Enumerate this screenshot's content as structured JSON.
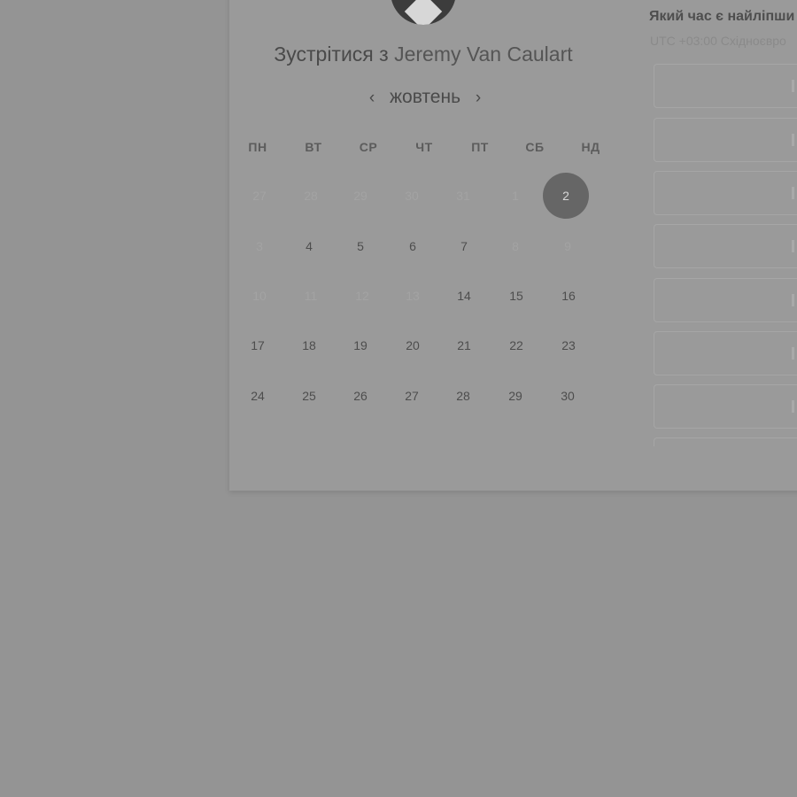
{
  "meeting": {
    "title_prefix": "Зустрітися з",
    "host_name": "Jeremy Van Caulart"
  },
  "calendar": {
    "month": "жовтень",
    "weekdays": [
      "ПН",
      "ВТ",
      "СР",
      "ЧТ",
      "ПТ",
      "СБ",
      "НД"
    ],
    "weeks": [
      [
        "27",
        "28",
        "29",
        "30",
        "31",
        "1",
        "2"
      ],
      [
        "3",
        "4",
        "5",
        "6",
        "7",
        "8",
        "9"
      ],
      [
        "10",
        "11",
        "12",
        "13",
        "14",
        "15",
        "16"
      ],
      [
        "17",
        "18",
        "19",
        "20",
        "21",
        "22",
        "23"
      ],
      [
        "24",
        "25",
        "26",
        "27",
        "28",
        "29",
        "30"
      ]
    ],
    "selected_day": "2"
  },
  "time_panel": {
    "title": "Який час є найліпши",
    "timezone": "UTC +03:00 Східноєвро"
  },
  "colors": {
    "overlay_background": "#949494",
    "card_background": "#9a9a9a",
    "selected_day": "#666666"
  }
}
